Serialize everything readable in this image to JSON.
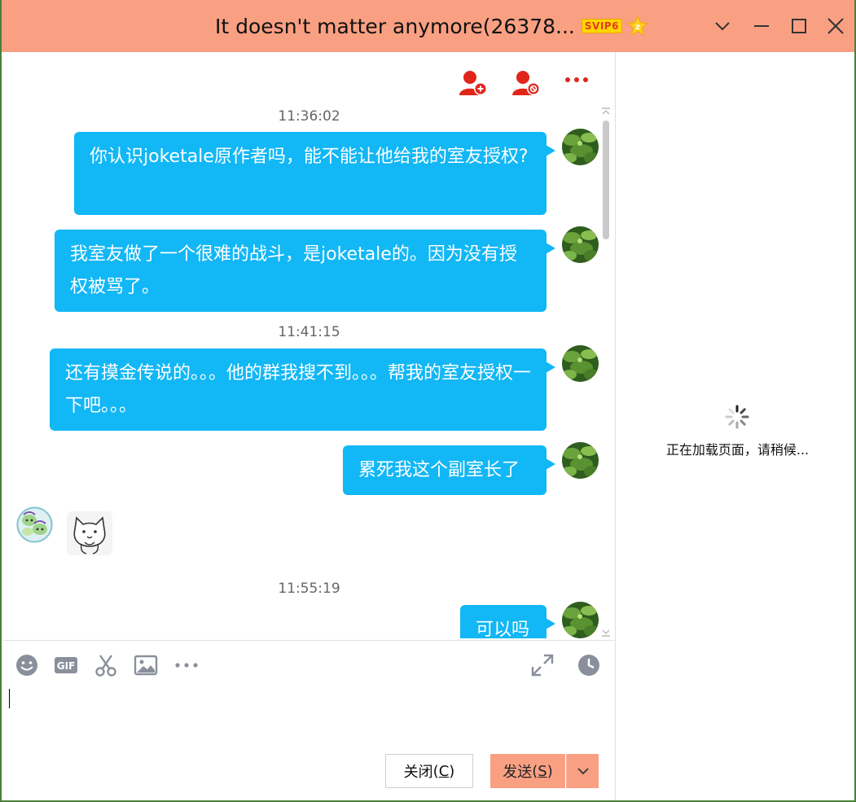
{
  "window": {
    "title": "It doesn't matter anymore(26378...",
    "badge": "SVIP6",
    "accent": "#f9a083"
  },
  "chat": {
    "messages": [
      {
        "time": "11:36:02",
        "text": "你认识joketale原作者吗，能不能让他给我的室友授权?"
      },
      {
        "text": "我室友做了一个很难的战斗，是joketale的。因为没有授权被骂了。"
      },
      {
        "time": "11:41:15",
        "text": "还有摸金传说的。。。他的群我搜不到。。。帮我的室友授权一下吧。。。"
      },
      {
        "text": "累死我这个副室长了"
      },
      {
        "sticker": "cat-sticker"
      },
      {
        "time": "11:55:19",
        "text": "可以吗"
      }
    ],
    "bubble_color": "#12b7f5"
  },
  "icons": {
    "add_friend": "add-friend-icon",
    "block": "block-icon",
    "more": "more-icon",
    "emoji": "emoji-icon",
    "gif": "gif-icon",
    "scissors": "screenshot-icon",
    "image": "image-icon",
    "more_tools": "more-tools-icon",
    "expand": "expand-icon",
    "history": "history-icon"
  },
  "toolbar": {
    "gif_label": "GIF"
  },
  "input": {
    "value": ""
  },
  "buttons": {
    "close_label": "关闭",
    "close_key": "C",
    "send_label": "发送",
    "send_key": "S"
  },
  "side": {
    "loading_text": "正在加载页面，请稍候..."
  }
}
